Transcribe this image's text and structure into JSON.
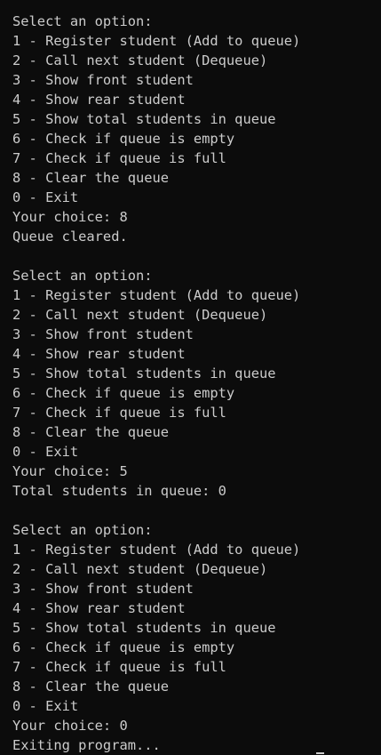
{
  "terminal": {
    "lines": [
      "Select an option:",
      "1 - Register student (Add to queue)",
      "2 - Call next student (Dequeue)",
      "3 - Show front student",
      "4 - Show rear student",
      "5 - Show total students in queue",
      "6 - Check if queue is empty",
      "7 - Check if queue is full",
      "8 - Clear the queue",
      "0 - Exit",
      "Your choice: 8",
      "Queue cleared.",
      "",
      "Select an option:",
      "1 - Register student (Add to queue)",
      "2 - Call next student (Dequeue)",
      "3 - Show front student",
      "4 - Show rear student",
      "5 - Show total students in queue",
      "6 - Check if queue is empty",
      "7 - Check if queue is full",
      "8 - Clear the queue",
      "0 - Exit",
      "Your choice: 5",
      "Total students in queue: 0",
      "",
      "Select an option:",
      "1 - Register student (Add to queue)",
      "2 - Call next student (Dequeue)",
      "3 - Show front student",
      "4 - Show rear student",
      "5 - Show total students in queue",
      "6 - Check if queue is empty",
      "7 - Check if queue is full",
      "8 - Clear the queue",
      "0 - Exit",
      "Your choice: 0",
      "Exiting program..."
    ]
  },
  "colors": {
    "background": "#0c0c0c",
    "text": "#cccccc"
  }
}
